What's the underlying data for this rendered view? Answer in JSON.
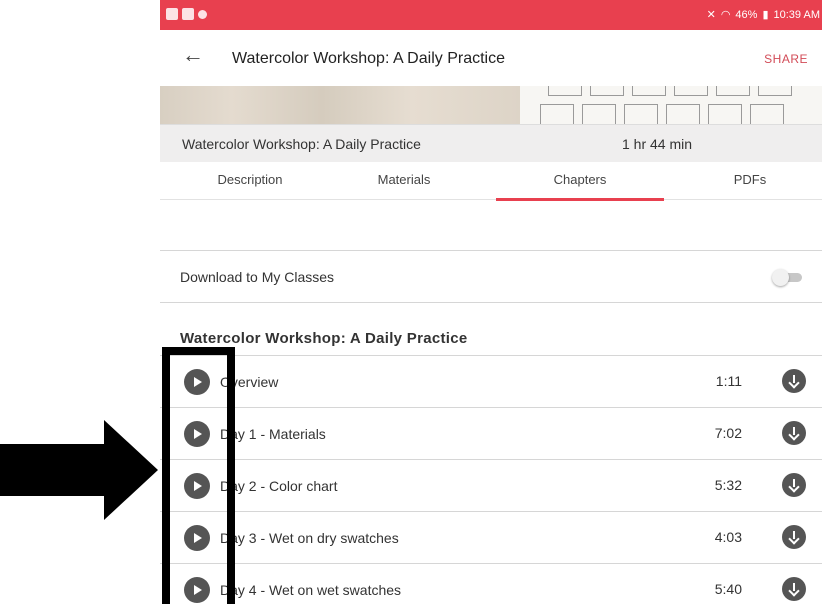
{
  "status_bar": {
    "battery": "46%",
    "time": "10:39 AM"
  },
  "app_bar": {
    "title": "Watercolor Workshop: A Daily Practice",
    "share_label": "SHARE",
    "back_icon": "arrow-left-icon"
  },
  "course": {
    "title": "Watercolor Workshop: A Daily Practice",
    "duration": "1 hr 44 min"
  },
  "tabs": [
    {
      "label": "Description",
      "active": false
    },
    {
      "label": "Materials",
      "active": false
    },
    {
      "label": "Chapters",
      "active": true
    },
    {
      "label": "PDFs",
      "active": false
    }
  ],
  "download": {
    "label": "Download to My Classes",
    "enabled": false
  },
  "section": {
    "heading": "Watercolor Workshop: A Daily Practice"
  },
  "chapters": [
    {
      "title": "Overview",
      "duration": "1:11"
    },
    {
      "title": "Day 1 - Materials",
      "duration": "7:02"
    },
    {
      "title": "Day 2 - Color chart",
      "duration": "5:32"
    },
    {
      "title": "Day 3 - Wet on dry swatches",
      "duration": "4:03"
    },
    {
      "title": "Day 4 - Wet on wet swatches",
      "duration": "5:40"
    }
  ],
  "colors": {
    "accent": "#e8404f",
    "annotation": "#000000"
  }
}
